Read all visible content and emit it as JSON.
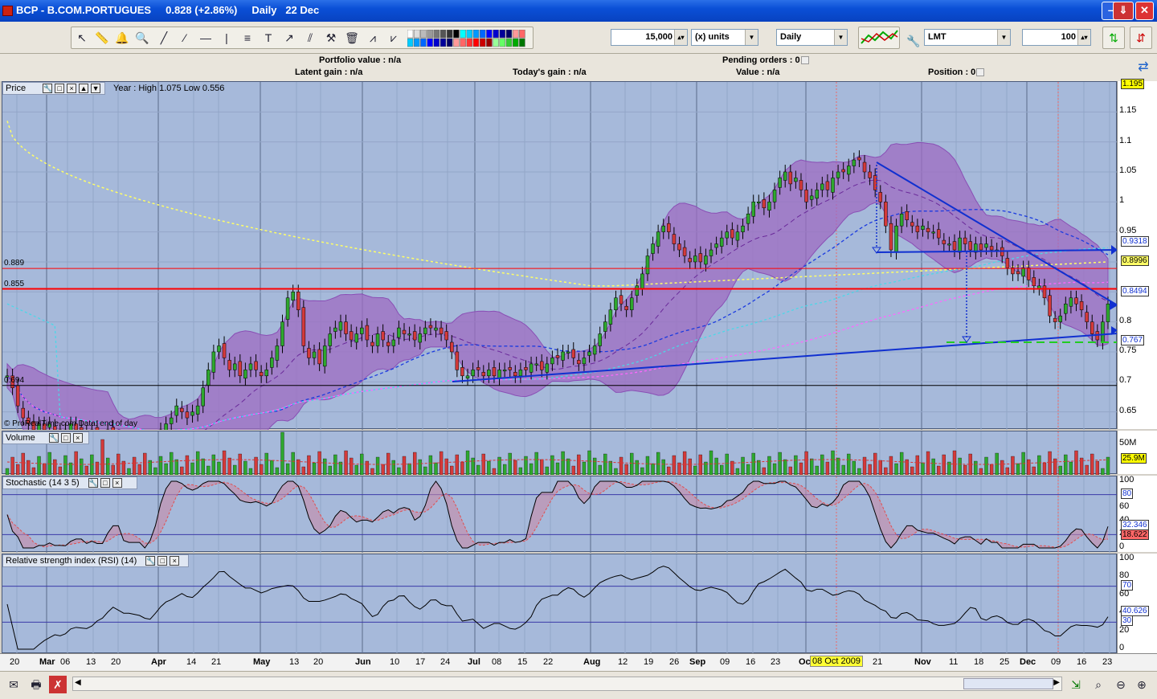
{
  "window": {
    "title": "BCP - B.COM.PORTUGUES     0.828 (+2.86%)     Daily   22 Dec"
  },
  "toolbar": {
    "quantity": "15,000",
    "quantity_unit": "(x) units",
    "period": "Daily",
    "order_type": "LMT",
    "limit": "100"
  },
  "info": {
    "portfolio_value": "Portfolio value : n/a",
    "latent_gain": "Latent gain : n/a",
    "todays_gain": "Today's gain : n/a",
    "pending_orders": "Pending orders : 0",
    "value": "Value : n/a",
    "position": "Position : 0"
  },
  "panes": {
    "price": {
      "title": "Price",
      "year_info": "Year : High 1.075 Low 0.556"
    },
    "volume": {
      "title": "Volume"
    },
    "stochastic": {
      "title": "Stochastic (14 3 5)"
    },
    "rsi": {
      "title": "Relative strength index (RSI) (14)"
    }
  },
  "copyright": "© ProRealTime.com  Data: end of day",
  "crosshair_date": "08 Oct 2009",
  "chart_data": [
    {
      "type": "candlestick",
      "title": "Price",
      "ylim": [
        0.62,
        1.2
      ],
      "y_ticks": [
        "1.195",
        "1.15",
        "1.1",
        "1.05",
        "1",
        "0.95",
        "0.9318",
        "0.8996",
        "0.8494",
        "0.8",
        "0.767",
        "0.75",
        "0.7",
        "0.65"
      ],
      "last_value_tags": [
        {
          "label": "1.195",
          "value": 1.195,
          "color": "#ffff00"
        },
        {
          "label": "0.9318",
          "value": 0.9318,
          "color": "#ffffff"
        },
        {
          "label": "0.8996",
          "value": 0.8996,
          "color": "#ffff66"
        },
        {
          "label": "0.8494",
          "value": 0.8494,
          "color": "#ffffff"
        },
        {
          "label": "0.767",
          "value": 0.767,
          "color": "#ffffff"
        }
      ],
      "horizontal_levels": [
        {
          "label": "0.889",
          "value": 0.889,
          "color": "#ff0000"
        },
        {
          "label": "0.855",
          "value": 0.855,
          "color": "#ff0000"
        },
        {
          "label": "0.694",
          "value": 0.694,
          "color": "#000000"
        }
      ],
      "x_labels": [
        "20",
        "Mar",
        "06",
        "13",
        "20",
        "Apr",
        "14",
        "21",
        "May",
        "13",
        "20",
        "Jun",
        "10",
        "17",
        "24",
        "Jul",
        "08",
        "15",
        "22",
        "Aug",
        "12",
        "19",
        "26",
        "Sep",
        "09",
        "16",
        "23",
        "Oc",
        "21",
        "Nov",
        "11",
        "18",
        "25",
        "Dec",
        "09",
        "16",
        "23"
      ],
      "close": [
        0.71,
        0.69,
        0.66,
        0.64,
        0.63,
        0.62,
        0.63,
        0.62,
        0.63,
        0.62,
        0.61,
        0.62,
        0.63,
        0.62,
        0.62,
        0.61,
        0.62,
        0.61,
        0.6,
        0.62,
        0.61,
        0.6,
        0.59,
        0.6,
        0.58,
        0.57,
        0.56,
        0.58,
        0.6,
        0.62,
        0.63,
        0.64,
        0.66,
        0.65,
        0.64,
        0.65,
        0.66,
        0.69,
        0.72,
        0.75,
        0.76,
        0.74,
        0.72,
        0.73,
        0.71,
        0.72,
        0.73,
        0.72,
        0.71,
        0.72,
        0.74,
        0.76,
        0.8,
        0.84,
        0.85,
        0.82,
        0.76,
        0.74,
        0.75,
        0.73,
        0.76,
        0.78,
        0.79,
        0.8,
        0.78,
        0.77,
        0.78,
        0.79,
        0.77,
        0.76,
        0.78,
        0.77,
        0.76,
        0.77,
        0.79,
        0.78,
        0.78,
        0.77,
        0.78,
        0.79,
        0.79,
        0.79,
        0.78,
        0.77,
        0.75,
        0.72,
        0.71,
        0.71,
        0.72,
        0.72,
        0.71,
        0.72,
        0.71,
        0.72,
        0.72,
        0.72,
        0.71,
        0.72,
        0.72,
        0.73,
        0.73,
        0.72,
        0.73,
        0.74,
        0.74,
        0.75,
        0.75,
        0.74,
        0.73,
        0.74,
        0.75,
        0.76,
        0.78,
        0.8,
        0.82,
        0.84,
        0.83,
        0.82,
        0.84,
        0.86,
        0.88,
        0.91,
        0.93,
        0.95,
        0.96,
        0.95,
        0.93,
        0.92,
        0.91,
        0.9,
        0.91,
        0.9,
        0.91,
        0.92,
        0.93,
        0.94,
        0.95,
        0.94,
        0.95,
        0.96,
        0.98,
        1.0,
        1.0,
        0.99,
        1.0,
        1.02,
        1.04,
        1.05,
        1.03,
        1.04,
        1.02,
        1.0,
        1.01,
        1.02,
        1.03,
        1.02,
        1.04,
        1.05,
        1.05,
        1.06,
        1.07,
        1.07,
        1.05,
        1.04,
        1.02,
        1.0,
        0.96,
        0.92,
        0.96,
        0.98,
        0.97,
        0.96,
        0.95,
        0.96,
        0.95,
        0.95,
        0.94,
        0.93,
        0.93,
        0.92,
        0.94,
        0.93,
        0.92,
        0.93,
        0.92,
        0.93,
        0.92,
        0.92,
        0.91,
        0.89,
        0.88,
        0.88,
        0.89,
        0.87,
        0.86,
        0.86,
        0.84,
        0.81,
        0.8,
        0.81,
        0.83,
        0.84,
        0.83,
        0.82,
        0.8,
        0.78,
        0.77,
        0.8,
        0.83
      ]
    },
    {
      "type": "bar",
      "title": "Volume",
      "y_ticks": [
        "50M"
      ],
      "last_value_tags": [
        {
          "label": "25.9M",
          "color": "#ffff00"
        }
      ]
    },
    {
      "type": "line",
      "title": "Stochastic (14 3 5)",
      "ylim": [
        0,
        100
      ],
      "y_ticks": [
        "100",
        "80",
        "60",
        "40",
        "20",
        "0"
      ],
      "last_value_tags": [
        {
          "label": "80",
          "value": 80,
          "color": "#ffffff"
        },
        {
          "label": "32.346",
          "value": 32.346,
          "color": "#ffffff"
        },
        {
          "label": "18.622",
          "value": 18.622,
          "color": "#ff6666"
        }
      ]
    },
    {
      "type": "line",
      "title": "Relative strength index (RSI) (14)",
      "ylim": [
        0,
        100
      ],
      "y_ticks": [
        "100",
        "80",
        "60",
        "40",
        "20",
        "0"
      ],
      "last_value_tags": [
        {
          "label": "70",
          "value": 70,
          "color": "#ffffff"
        },
        {
          "label": "40.626",
          "value": 40.626,
          "color": "#ffffff"
        },
        {
          "label": "30",
          "value": 30,
          "color": "#ffffff"
        }
      ]
    }
  ]
}
